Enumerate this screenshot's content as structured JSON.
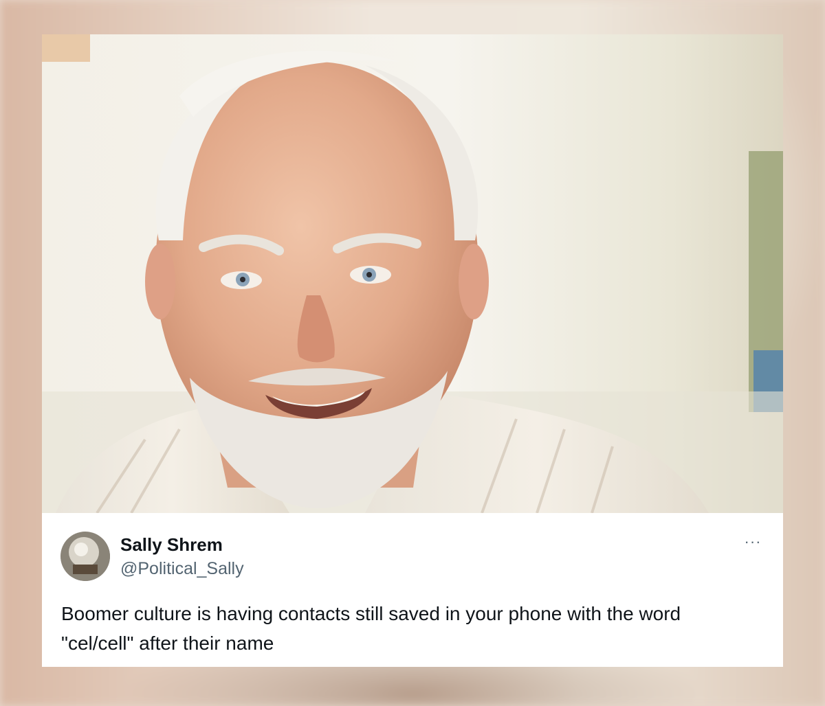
{
  "tweet": {
    "display_name": "Sally Shrem",
    "handle": "@Political_Sally",
    "more_label": "···",
    "text": "Boomer culture is having contacts still saved in your phone with the word \"cel/cell\" after their name"
  },
  "icons": {
    "more": "more-options-icon"
  },
  "colors": {
    "name": "#0f1419",
    "handle": "#536471",
    "card_background": "#ffffff"
  }
}
